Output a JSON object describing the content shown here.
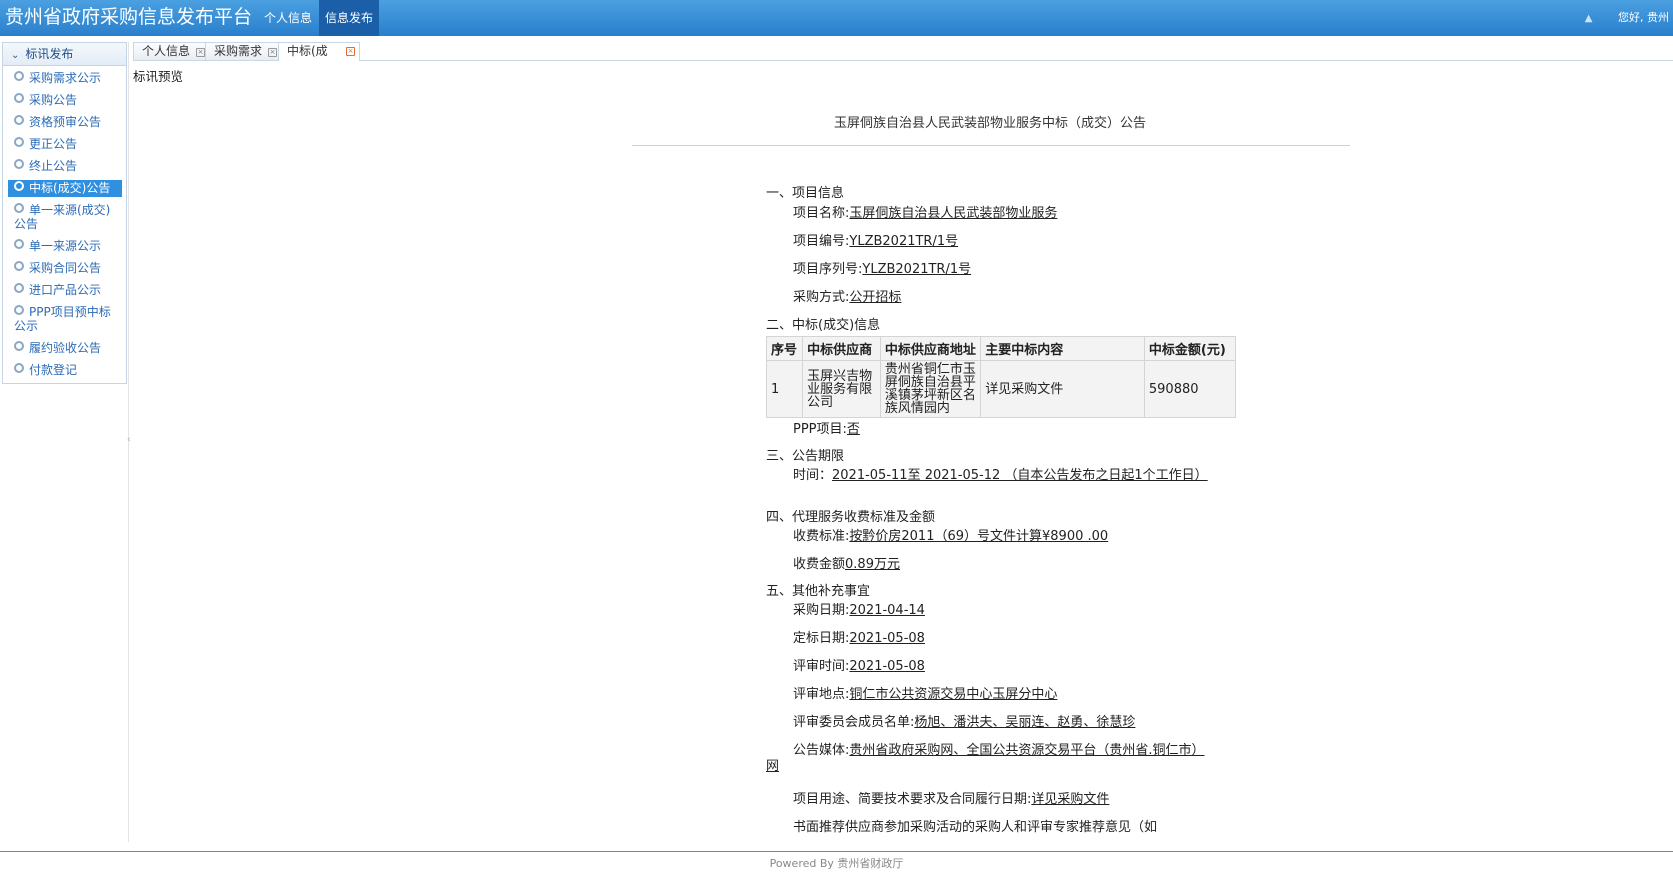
{
  "header": {
    "title": "贵州省政府采购信息发布平台",
    "nav": [
      "个人信息",
      "信息发布"
    ],
    "greeting": "您好, 贵州"
  },
  "sidebar": {
    "header": "标讯发布",
    "items": [
      "采购需求公示",
      "采购公告",
      "资格预审公告",
      "更正公告",
      "终止公告",
      "中标(成交)公告",
      "单一来源(成交)公告",
      "单一来源公示",
      "采购合同公告",
      "进口产品公示",
      "PPP项目预中标公示",
      "履约验收公告",
      "付款登记"
    ]
  },
  "tabs": [
    "个人信息",
    "采购需求",
    "中标(成"
  ],
  "panel_title": "标讯预览",
  "document": {
    "title": "玉屏侗族自治县人民武装部物业服务中标（成交）公告",
    "s1": "一、项目信息",
    "project_name_label": "项目名称:",
    "project_name": "玉屏侗族自治县人民武装部物业服务",
    "project_no_label": "项目编号:",
    "project_no": "YLZB2021TR/1号",
    "project_seq_label": "项目序列号:",
    "project_seq": "YLZB2021TR/1号",
    "method_label": "采购方式:",
    "method": "公开招标",
    "s2": "二、中标(成交)信息",
    "table_headers": [
      "序号",
      "中标供应商",
      "中标供应商地址",
      "主要中标内容",
      "中标金额(元)"
    ],
    "table_row": [
      "1",
      "玉屏兴吉物业服务有限公司",
      "贵州省铜仁市玉屏侗族自治县平溪镇茅坪新区名族风情园内",
      "详见采购文件",
      "590880"
    ],
    "ppp_label": "PPP项目:",
    "ppp": "否",
    "s3": "三、公告期限",
    "period_label": "时间：",
    "period": "2021-05-11至 2021-05-12 （自本公告发布之日起1个工作日）",
    "s4": "四、代理服务收费标准及金额",
    "fee_std_label": "收费标准:",
    "fee_std": "按黔价房2011（69）号文件计算¥8900 .00",
    "fee_amt_label": "收费金额",
    "fee_amt": "0.89万元",
    "s5": "五、其他补充事宜",
    "purchase_date_label": "采购日期:",
    "purchase_date": "2021-04-14",
    "award_date_label": "定标日期:",
    "award_date": "2021-05-08",
    "review_time_label": "评审时间:",
    "review_time": "2021-05-08",
    "review_place_label": "评审地点:",
    "review_place": "铜仁市公共资源交易中心玉屏分中心",
    "committee_label": "评审委员会成员名单:",
    "committee": "杨旭、潘洪夫、吴丽连、赵勇、徐慧珍",
    "media_label": "公告媒体:",
    "media": "贵州省政府采购网、全国公共资源交易平台（贵州省.铜仁市）网",
    "usage_label": "项目用途、简要技术要求及合同履行日期:",
    "usage": "详见采购文件",
    "recommend": "书面推荐供应商参加采购活动的采购人和评审专家推荐意见（如"
  },
  "footer": "Powered By 贵州省财政厅"
}
